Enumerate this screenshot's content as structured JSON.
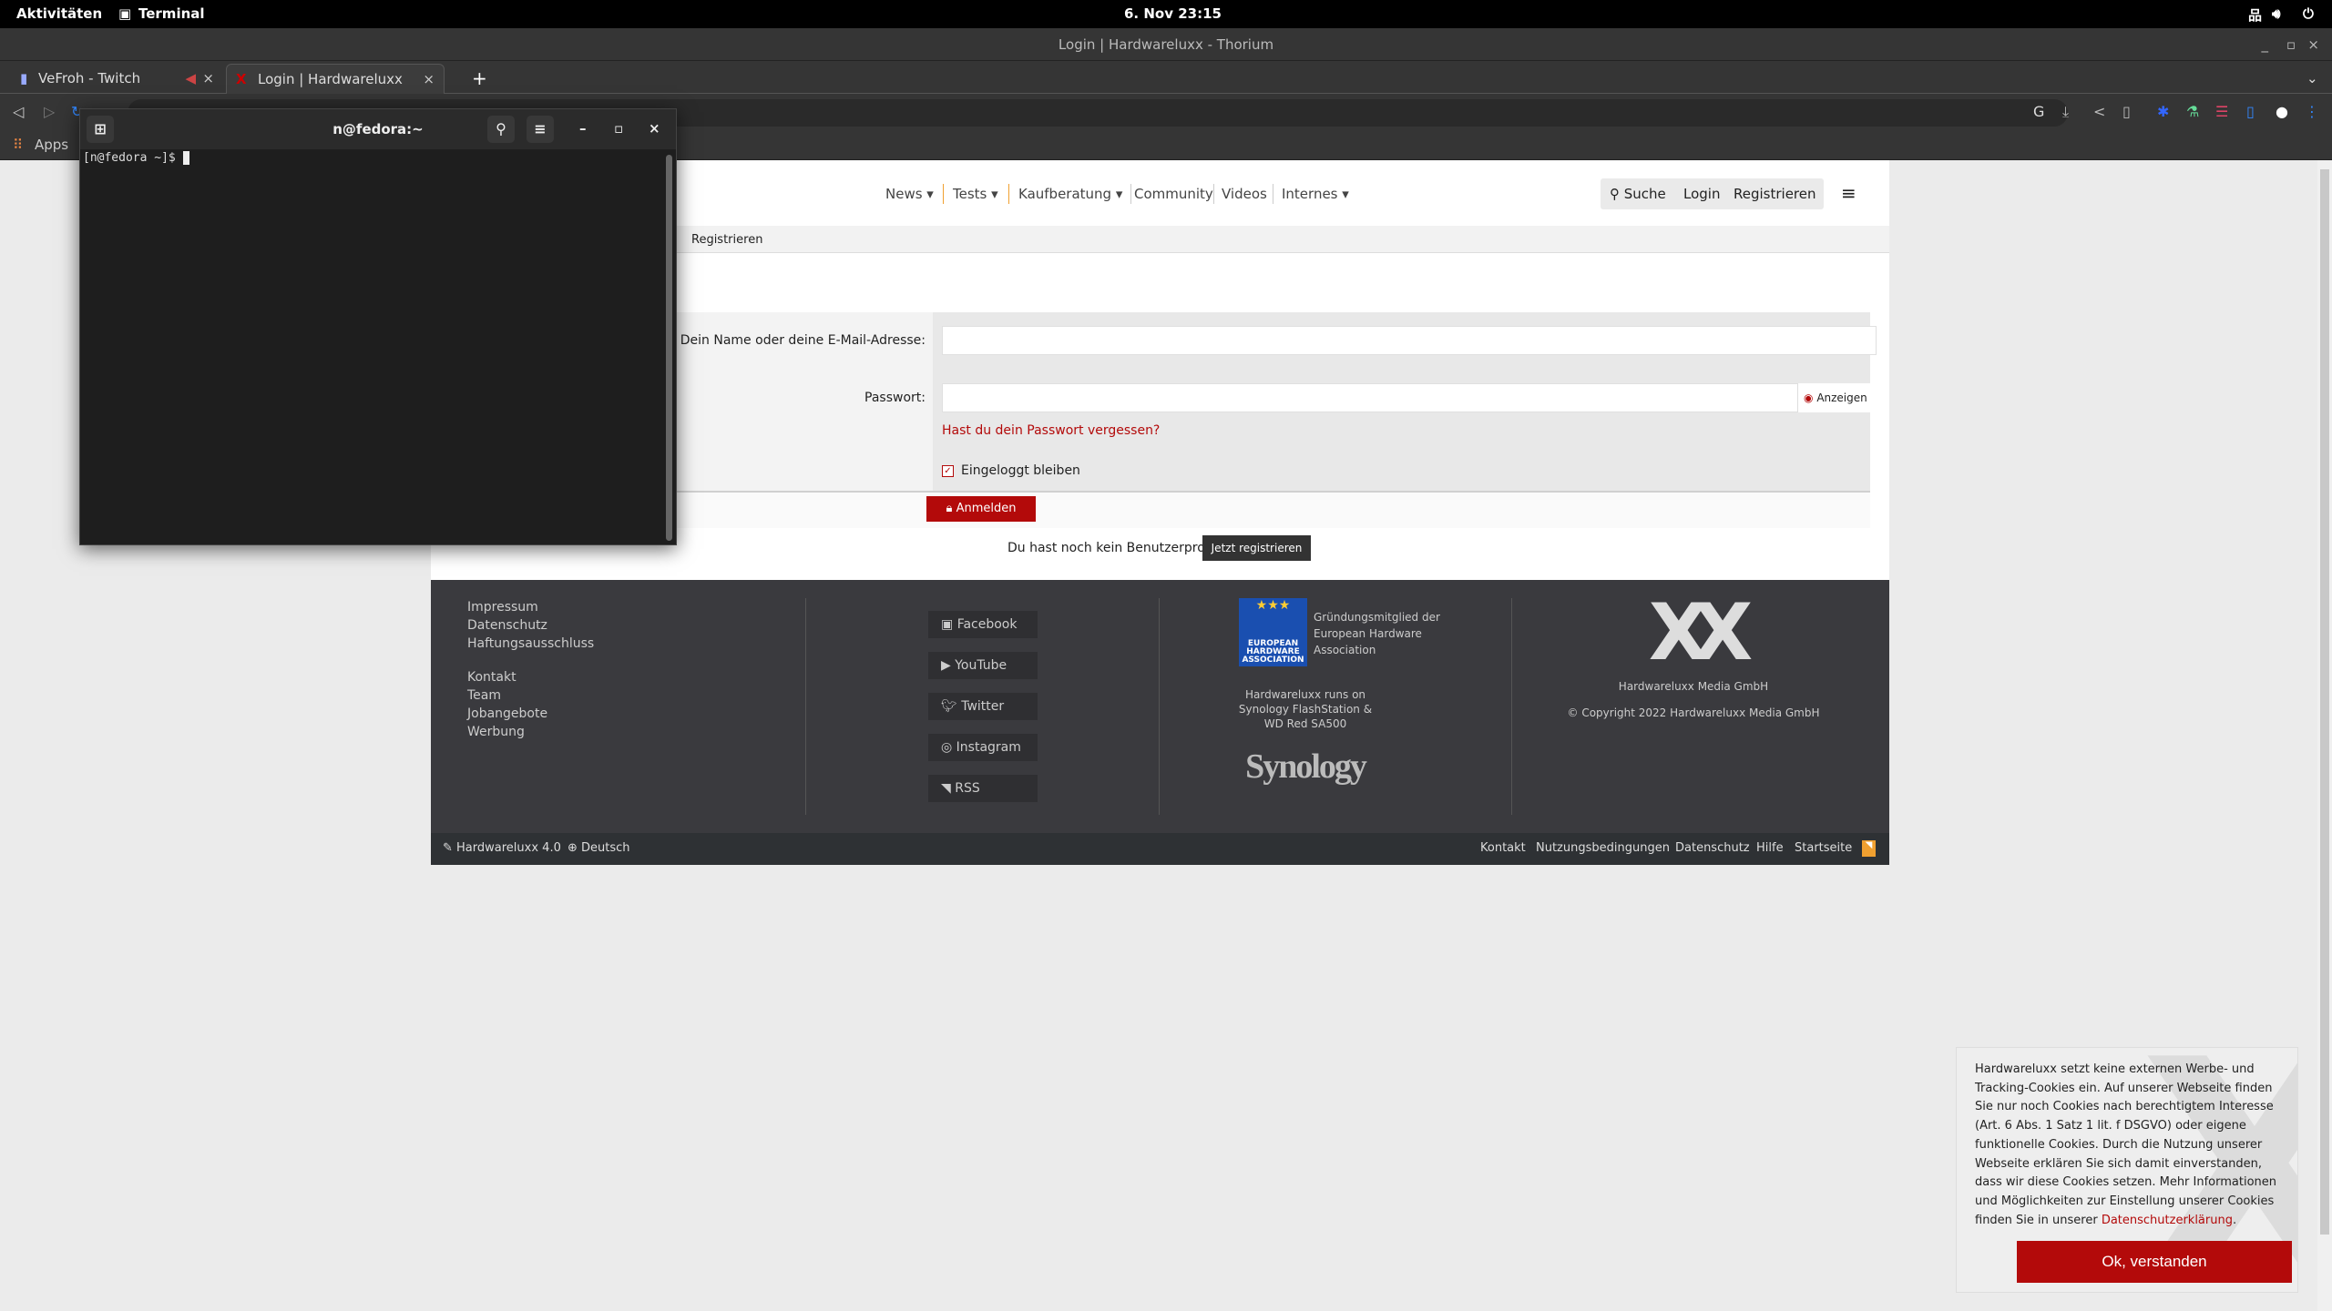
{
  "system": {
    "activities": "Aktivitäten",
    "app": "Terminal",
    "clock": "6. Nov  23:15"
  },
  "window": {
    "title": "Login | Hardwareluxx - Thorium"
  },
  "tabs": [
    {
      "label": "VeFroh - Twitch"
    },
    {
      "label": "Login | Hardwareluxx"
    }
  ],
  "bookmarks": {
    "apps": "Apps"
  },
  "terminal": {
    "title": "n@fedora:~",
    "prompt": "[n@fedora ~]$ "
  },
  "site": {
    "nav": [
      "News ▾",
      "Tests ▾",
      "Kaufberatung ▾",
      "Community",
      "Videos",
      "Internes ▾"
    ],
    "search": "Suche",
    "login": "Login",
    "register": "Registrieren",
    "breadcrumb": "Registrieren",
    "form": {
      "name_label": "Dein Name oder deine E-Mail-Adresse:",
      "name_value": "",
      "password_label": "Passwort:",
      "password_value": "",
      "show": "Anzeigen",
      "forgot": "Hast du dein Passwort vergessen?",
      "remember": "Eingeloggt bleiben",
      "remember_checked": true,
      "submit": "Anmelden",
      "no_profile": "Du hast noch kein Benutzerprofil?",
      "register_now": "Jetzt registrieren"
    },
    "footer": {
      "links1": [
        "Impressum",
        "Datenschutz",
        "Haftungsausschluss"
      ],
      "links2": [
        "Kontakt",
        "Team",
        "Jobangebote",
        "Werbung"
      ],
      "social": [
        "Facebook",
        "YouTube",
        "Twitter",
        "Instagram",
        "RSS"
      ],
      "eha_logo": "EUROPEAN HARDWARE ASSOCIATION",
      "eha": [
        "Gründungsmitglied der",
        "European Hardware",
        "Association"
      ],
      "synology_text": [
        "Hardwareluxx runs on",
        "Synology FlashStation &",
        "WD Red SA500"
      ],
      "synology_logo": "Synology",
      "company": "Hardwareluxx Media GmbH",
      "copyright": "© Copyright 2022 Hardwareluxx Media GmbH"
    },
    "bottom": {
      "version": "Hardwareluxx 4.0",
      "language": "Deutsch",
      "links": [
        "Kontakt",
        "Nutzungsbedingungen",
        "Datenschutz",
        "Hilfe",
        "Startseite"
      ]
    }
  },
  "cookie": {
    "text": "Hardwareluxx setzt keine externen Werbe- und Tracking-Cookies ein. Auf unserer Webseite finden Sie nur noch Cookies nach berechtigtem Interesse (Art. 6 Abs. 1 Satz 1 lit. f DSGVO) oder eigene funktionelle Cookies. Durch die Nutzung unserer Webseite erklären Sie sich damit einverstanden, dass wir diese Cookies setzen. Mehr Informationen und Möglichkeiten zur Einstellung unserer Cookies finden Sie in unserer ",
    "link": "Datenschutzerklärung",
    "ok": "Ok, verstanden"
  },
  "colors": {
    "accent": "#b30a0a",
    "footer": "#3a3a3e",
    "nav_separator_orange": "#f0a030"
  }
}
